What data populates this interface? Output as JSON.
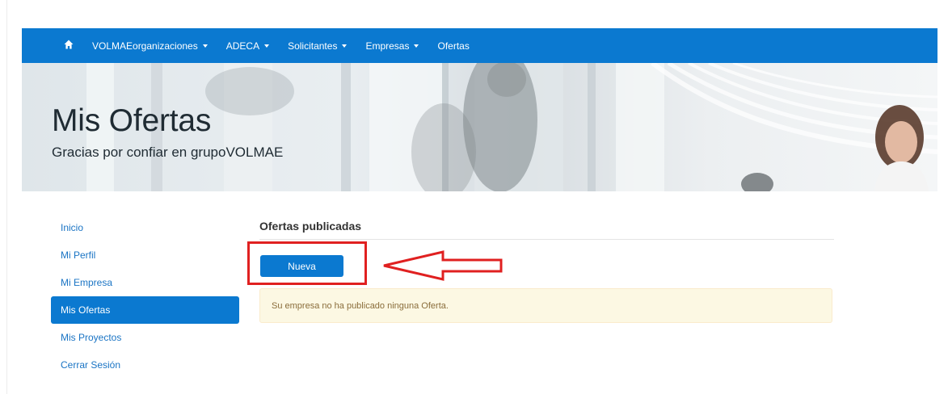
{
  "navbar": {
    "home_icon": "home-icon",
    "items": [
      {
        "label": "VOLMAEorganizaciones",
        "dropdown": true
      },
      {
        "label": "ADECA",
        "dropdown": true
      },
      {
        "label": "Solicitantes",
        "dropdown": true
      },
      {
        "label": "Empresas",
        "dropdown": true
      },
      {
        "label": "Ofertas",
        "dropdown": false
      }
    ],
    "color": "#0b79d0"
  },
  "hero": {
    "title": "Mis Ofertas",
    "subtitle": "Gracias por confiar en grupoVOLMAE"
  },
  "sidebar": {
    "items": [
      {
        "label": "Inicio",
        "active": false
      },
      {
        "label": "Mi Perfil",
        "active": false
      },
      {
        "label": "Mi Empresa",
        "active": false
      },
      {
        "label": "Mis Ofertas",
        "active": true
      },
      {
        "label": "Mis Proyectos",
        "active": false
      },
      {
        "label": "Cerrar Sesión",
        "active": false
      }
    ]
  },
  "main": {
    "section_title": "Ofertas publicadas",
    "new_button_label": "Nueva",
    "alert_text": "Su empresa no ha publicado ninguna Oferta."
  },
  "annotation": {
    "color": "#e02020",
    "highlighted": "new-offer-button"
  }
}
